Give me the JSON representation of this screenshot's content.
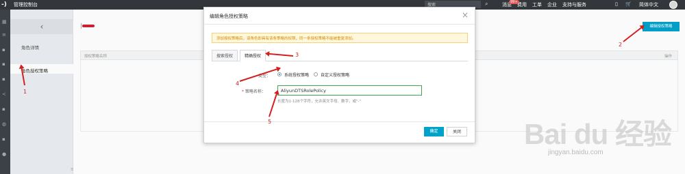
{
  "topbar": {
    "title": "管理控制台",
    "search_placeholder": "搜索",
    "badge": "99+",
    "items": [
      "消息",
      "费用",
      "工单",
      "企业",
      "支持与服务",
      "简体中文"
    ]
  },
  "subnav": {
    "items": [
      "角色详情",
      "角色授权策略"
    ]
  },
  "main": {
    "edit_button": "编辑授权策略",
    "grid_col1": "授权策略名称",
    "grid_col_last": "操作"
  },
  "modal": {
    "title": "编辑角色授权策略",
    "notice": "添加授权策略后，该角色即具有该条策略的权限，同一条授权策略不能被重复添加。",
    "tabs": [
      "搜索授权",
      "精确授权"
    ],
    "type_label": "类型：",
    "type_options": [
      "系统授权策略",
      "自定义授权策略"
    ],
    "name_label": "策略名称：",
    "name_value": "AliyunDTSRolePolicy",
    "hint": "长度为1-128个字符，允许英文字母、数字，或\"-\"",
    "ok": "确定",
    "close": "关闭"
  },
  "annotations": [
    "1",
    "2",
    "3",
    "4",
    "5"
  ],
  "watermark": {
    "text": "Bai du 经验",
    "url": "jingyan.baidu.com"
  }
}
